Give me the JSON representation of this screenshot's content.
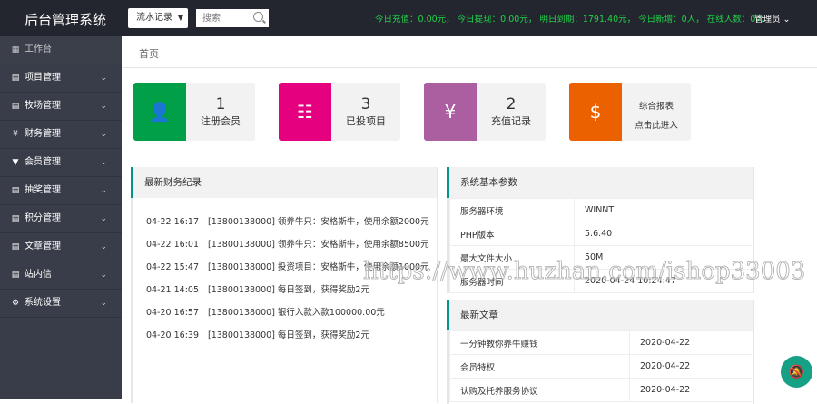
{
  "header": {
    "title": "后台管理系统",
    "select_value": "流水记录",
    "search_placeholder": "搜索",
    "stats": "今日充值：0.00元， 今日提现：0.00元， 明日到期：1791.40元， 今日新增：0人， 在线人数：0人",
    "admin": "管理员"
  },
  "sidebar": {
    "items": [
      {
        "label": "工作台",
        "icon": "dashboard-icon"
      },
      {
        "label": "项目管理",
        "icon": "document-icon"
      },
      {
        "label": "牧场管理",
        "icon": "document-icon"
      },
      {
        "label": "财务管理",
        "icon": "yen-icon"
      },
      {
        "label": "会员管理",
        "icon": "shield-icon"
      },
      {
        "label": "抽奖管理",
        "icon": "document-icon"
      },
      {
        "label": "积分管理",
        "icon": "document-icon"
      },
      {
        "label": "文章管理",
        "icon": "document-icon"
      },
      {
        "label": "站内信",
        "icon": "message-icon"
      },
      {
        "label": "系统设置",
        "icon": "gear-icon"
      }
    ]
  },
  "breadcrumb": "首页",
  "cards": [
    {
      "num": "1",
      "label": "注册会员",
      "color": "#009f48"
    },
    {
      "num": "3",
      "label": "已投项目",
      "color": "#e4007f"
    },
    {
      "num": "2",
      "label": "充值记录",
      "color": "#ac5fa0"
    },
    {
      "line1": "综合报表",
      "line2": "点击此进入",
      "color": "#eb6100"
    }
  ],
  "finance": {
    "title": "最新财务纪录",
    "records": [
      {
        "time": "04-22 16:17",
        "text": "[13800138000] 领养牛只：安格斯牛，使用余额2000元"
      },
      {
        "time": "04-22 16:01",
        "text": "[13800138000] 领养牛只：安格斯牛，使用余额8500元"
      },
      {
        "time": "04-22 15:47",
        "text": "[13800138000] 投资项目：安格斯牛，使用余额1000元"
      },
      {
        "time": "04-21 14:05",
        "text": "[13800138000] 每日签到，获得奖励2元"
      },
      {
        "time": "04-20 16:57",
        "text": "[13800138000] 银行入款入款100000.00元"
      },
      {
        "time": "04-20 16:39",
        "text": "[13800138000] 每日签到，获得奖励2元"
      }
    ]
  },
  "system": {
    "title": "系统基本参数",
    "rows": [
      [
        "服务器环境",
        "WINNT"
      ],
      [
        "PHP版本",
        "5.6.40"
      ],
      [
        "最大文件大小",
        "50M"
      ],
      [
        "服务器时间",
        "2020-04-24 10:24:47"
      ]
    ]
  },
  "articles": {
    "title": "最新文章",
    "rows": [
      [
        "一分钟教你养牛赚钱",
        "2020-04-22"
      ],
      [
        "会员特权",
        "2020-04-22"
      ],
      [
        "认购及托养服务协议",
        "2020-04-22"
      ]
    ]
  },
  "watermark": "https://www.huzhan.com/ishop33003"
}
